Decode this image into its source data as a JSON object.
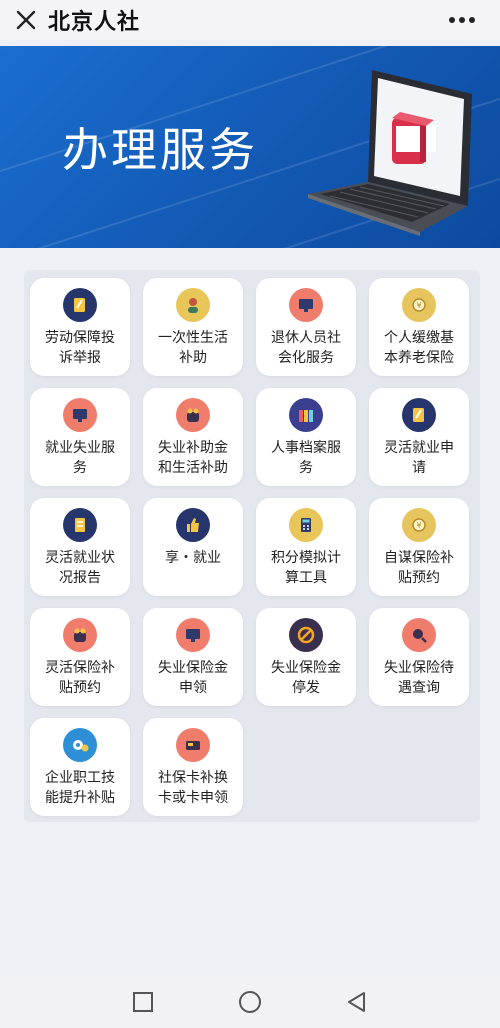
{
  "header": {
    "title": "北京人社",
    "close_icon": "close-icon",
    "more_icon": "more-icon"
  },
  "banner": {
    "title": "办理服务"
  },
  "services": [
    {
      "line1": "劳动保障投",
      "line2": "诉举报",
      "icon": "pen-icon",
      "color": "#26356b"
    },
    {
      "line1": "一次性生活",
      "line2": "补助",
      "icon": "person-icon",
      "color": "#e9c65a"
    },
    {
      "line1": "退休人员社",
      "line2": "会化服务",
      "icon": "computer-icon",
      "color": "#f07d6c"
    },
    {
      "line1": "个人缓缴基",
      "line2": "本养老保险",
      "icon": "coin-icon",
      "color": "#e6c55f"
    },
    {
      "line1": "就业失业服",
      "line2": "务",
      "icon": "computer-icon",
      "color": "#f07d6c"
    },
    {
      "line1": "失业补助金",
      "line2": "和生活补助",
      "icon": "money-bag-icon",
      "color": "#f07d6c"
    },
    {
      "line1": "人事档案服",
      "line2": "务",
      "icon": "folder-icon",
      "color": "#3a3f8f"
    },
    {
      "line1": "灵活就业申",
      "line2": "请",
      "icon": "pen-icon",
      "color": "#26356b"
    },
    {
      "line1": "灵活就业状",
      "line2": "况报告",
      "icon": "document-icon",
      "color": "#26356b"
    },
    {
      "line1": "享・就业",
      "line2": "",
      "icon": "thumbs-up-icon",
      "color": "#26356b"
    },
    {
      "line1": "积分模拟计",
      "line2": "算工具",
      "icon": "calculator-icon",
      "color": "#e9c65a"
    },
    {
      "line1": "自谋保险补",
      "line2": "贴预约",
      "icon": "coin-icon",
      "color": "#e6c55f"
    },
    {
      "line1": "灵活保险补",
      "line2": "贴预约",
      "icon": "money-bag-icon",
      "color": "#f07d6c"
    },
    {
      "line1": "失业保险金",
      "line2": "申领",
      "icon": "computer-icon",
      "color": "#f07d6c"
    },
    {
      "line1": "失业保险金",
      "line2": "停发",
      "icon": "prohibited-icon",
      "color": "#3a2f4f"
    },
    {
      "line1": "失业保险待",
      "line2": "遇查询",
      "icon": "search-icon",
      "color": "#f07d6c"
    },
    {
      "line1": "企业职工技",
      "line2": "能提升补贴",
      "icon": "gear-coin-icon",
      "color": "#2f8fd6"
    },
    {
      "line1": "社保卡补换",
      "line2": "卡或卡申领",
      "icon": "card-icon",
      "color": "#f07d6c"
    }
  ],
  "navbar": {
    "recent_icon": "square-icon",
    "home_icon": "circle-icon",
    "back_icon": "triangle-back-icon"
  }
}
